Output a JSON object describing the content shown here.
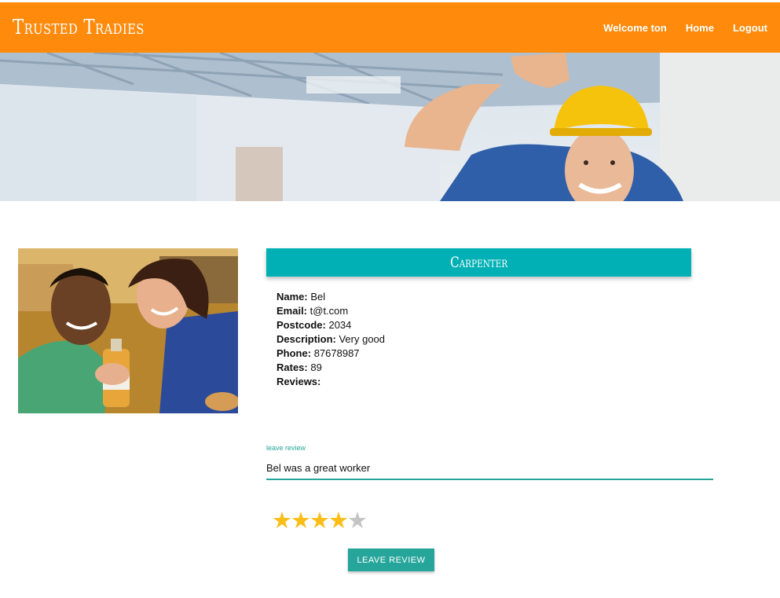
{
  "navbar": {
    "brand": "Trusted Tradies",
    "links": [
      {
        "label": "Welcome ton"
      },
      {
        "label": "Home"
      },
      {
        "label": "Logout"
      }
    ],
    "color": "#ff8a0b"
  },
  "trade": {
    "title": "Carpenter",
    "color": "#00b0b5"
  },
  "profile": {
    "fields": [
      {
        "label": "Name:",
        "value": "Bel"
      },
      {
        "label": "Email:",
        "value": "t@t.com"
      },
      {
        "label": "Postcode:",
        "value": "2034"
      },
      {
        "label": "Description:",
        "value": "Very good"
      },
      {
        "label": "Phone:",
        "value": "87678987"
      },
      {
        "label": "Rates:",
        "value": "89"
      },
      {
        "label": "Reviews:",
        "value": ""
      }
    ]
  },
  "review": {
    "label": "leave review",
    "value": "Bel was a great worker",
    "rating": 4,
    "max_rating": 5,
    "submit_label": "Leave Review",
    "accent": "#26a69a"
  }
}
